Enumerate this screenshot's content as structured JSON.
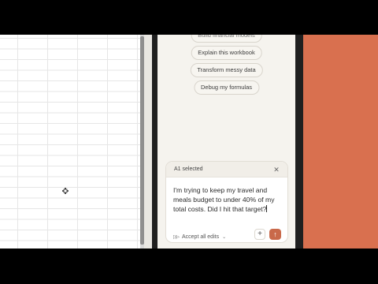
{
  "sidebar": {
    "suggestions": [
      {
        "label": "Build financial models"
      },
      {
        "label": "Explain this workbook"
      },
      {
        "label": "Transform messy data"
      },
      {
        "label": "Debug my formulas"
      }
    ]
  },
  "composer": {
    "selection_label": "A1 selected",
    "close_icon": "close-icon",
    "message": "I'm trying to keep my travel and meals budget to under 40% of my total costs. Did I hit that target?",
    "accept_label": "Accept all edits",
    "accept_icon": "fast-forward-icon",
    "chevron_icon": "chevron-down-icon",
    "add_icon": "plus-icon",
    "send_icon": "arrow-up-icon"
  },
  "colors": {
    "accent": "#d9704f",
    "send_button": "#c9694a",
    "panel_bg": "#f5f3ee"
  }
}
